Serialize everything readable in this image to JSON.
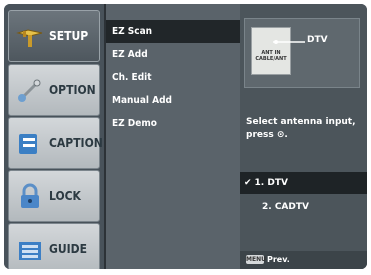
{
  "tabs": [
    {
      "label": "SETUP",
      "icon": "setup-icon",
      "active": true
    },
    {
      "label": "OPTION",
      "icon": "option-icon",
      "active": false
    },
    {
      "label": "CAPTION",
      "icon": "caption-icon",
      "active": false
    },
    {
      "label": "LOCK",
      "icon": "lock-icon",
      "active": false
    },
    {
      "label": "GUIDE",
      "icon": "guide-icon",
      "active": false
    }
  ],
  "menu": {
    "items": [
      "EZ Scan",
      "EZ Add",
      "Ch. Edit",
      "Manual Add",
      "EZ Demo"
    ],
    "selected": "EZ Scan"
  },
  "panel": {
    "preview_label": "DTV",
    "preview_box_text": "ANT IN",
    "preview_box_subtext": "CABLE/ANT",
    "description": "Select antenna input, press ⊙.",
    "options": [
      "1. DTV",
      "2. CADTV"
    ],
    "selected_option": "1. DTV",
    "check": "✔",
    "footer_button": "MENU",
    "footer_text": "Prev."
  },
  "colors": {
    "background": "#3f474d",
    "active_tab": "#5a636a",
    "inactive_tab": "#c8cdd0",
    "selection": "#212629"
  }
}
